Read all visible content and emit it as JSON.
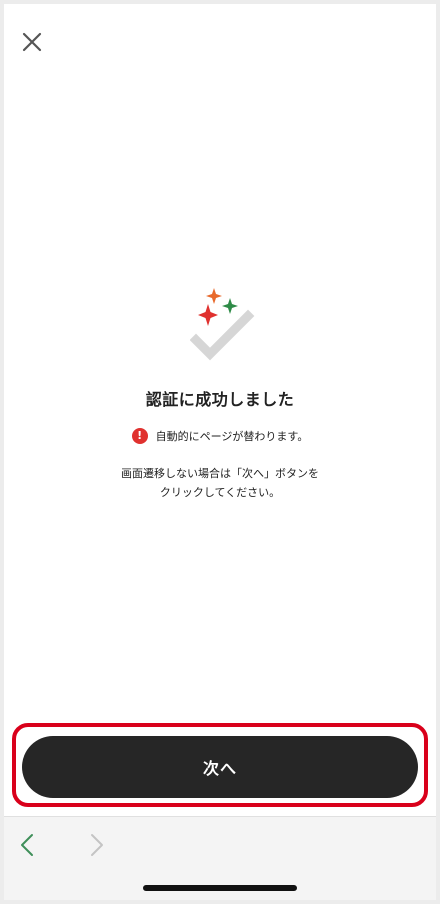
{
  "header": {
    "close_icon": "close-icon"
  },
  "success": {
    "graphic_icon": "sparkle-check-icon",
    "sparkle_colors": [
      "#e86a2c",
      "#e0312f",
      "#2e8b47"
    ],
    "check_color": "#d6d6d6",
    "title": "認証に成功しました"
  },
  "notice": {
    "icon": "alert-icon",
    "icon_glyph": "!",
    "icon_color": "#e0312f",
    "text": "自動的にページが替わります。"
  },
  "instructions": {
    "line1": "画面遷移しない場合は「次へ」ボタンを",
    "line2": "クリックしてください。"
  },
  "action": {
    "next_label": "次へ",
    "highlight_color": "#d9001b"
  },
  "browser_nav": {
    "back_icon": "chevron-left-icon",
    "forward_icon": "chevron-right-icon"
  }
}
